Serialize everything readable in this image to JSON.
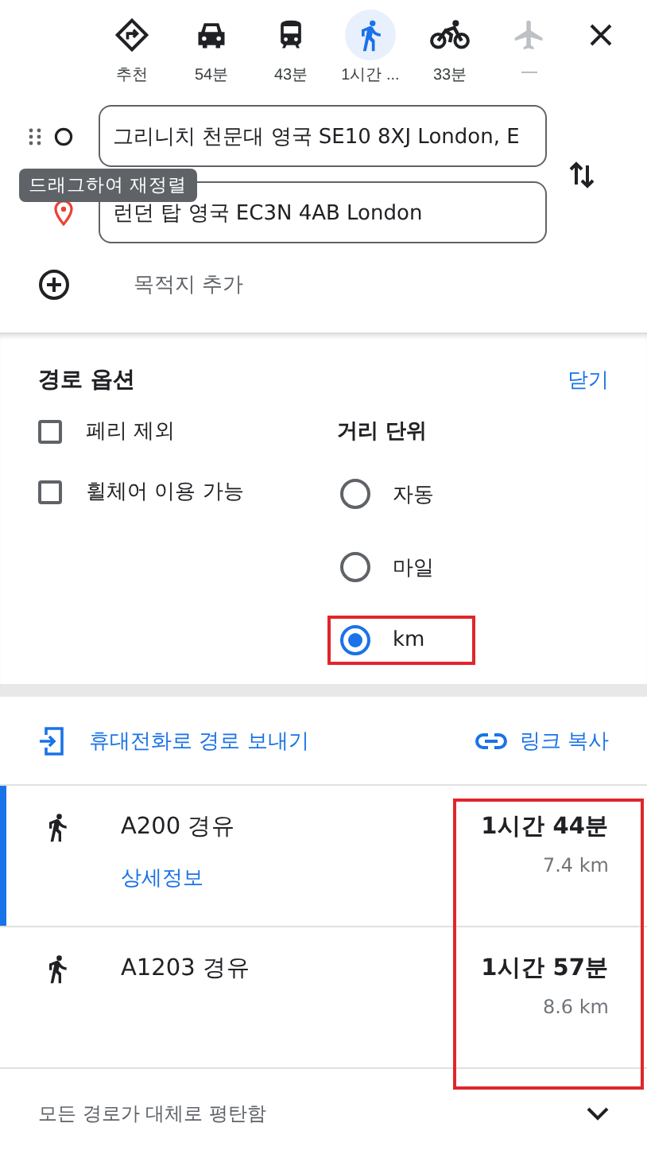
{
  "modes": [
    {
      "kind": "best",
      "label": "추천",
      "selected": false,
      "disabled": false
    },
    {
      "kind": "car",
      "label": "54분",
      "selected": false,
      "disabled": false
    },
    {
      "kind": "transit",
      "label": "43분",
      "selected": false,
      "disabled": false
    },
    {
      "kind": "walk",
      "label": "1시간 ...",
      "selected": true,
      "disabled": false
    },
    {
      "kind": "bike",
      "label": "33분",
      "selected": false,
      "disabled": false
    },
    {
      "kind": "flight",
      "label": "—",
      "selected": false,
      "disabled": true
    }
  ],
  "waypoints": [
    {
      "kind": "origin",
      "value": "그리니치 천문대 영국 SE10 8XJ London, E"
    },
    {
      "kind": "destination",
      "value": "런던 탑 영국 EC3N 4AB London"
    }
  ],
  "tooltip": "드래그하여 재정렬",
  "add_destination": "목적지 추가",
  "options": {
    "title": "경로 옵션",
    "close": "닫기",
    "checkboxes": [
      {
        "label": "페리 제외",
        "checked": false
      },
      {
        "label": "휠체어 이용 가능",
        "checked": false
      }
    ],
    "units": {
      "title": "거리 단위",
      "options": [
        {
          "label": "자동",
          "selected": false,
          "highlighted": false
        },
        {
          "label": "마일",
          "selected": false,
          "highlighted": false
        },
        {
          "label": "km",
          "selected": true,
          "highlighted": true
        }
      ]
    }
  },
  "send_to_phone": "휴대전화로 경로 보내기",
  "copy_link": "링크 복사",
  "routes_times_highlighted": true,
  "routes": [
    {
      "name": "A200 경유",
      "duration": "1시간 44분",
      "distance": "7.4 km",
      "details": "상세정보",
      "selected": true
    },
    {
      "name": "A1203 경유",
      "duration": "1시간 57분",
      "distance": "8.6 km",
      "selected": false
    }
  ],
  "footer": "모든 경로가 대체로 평탄함"
}
